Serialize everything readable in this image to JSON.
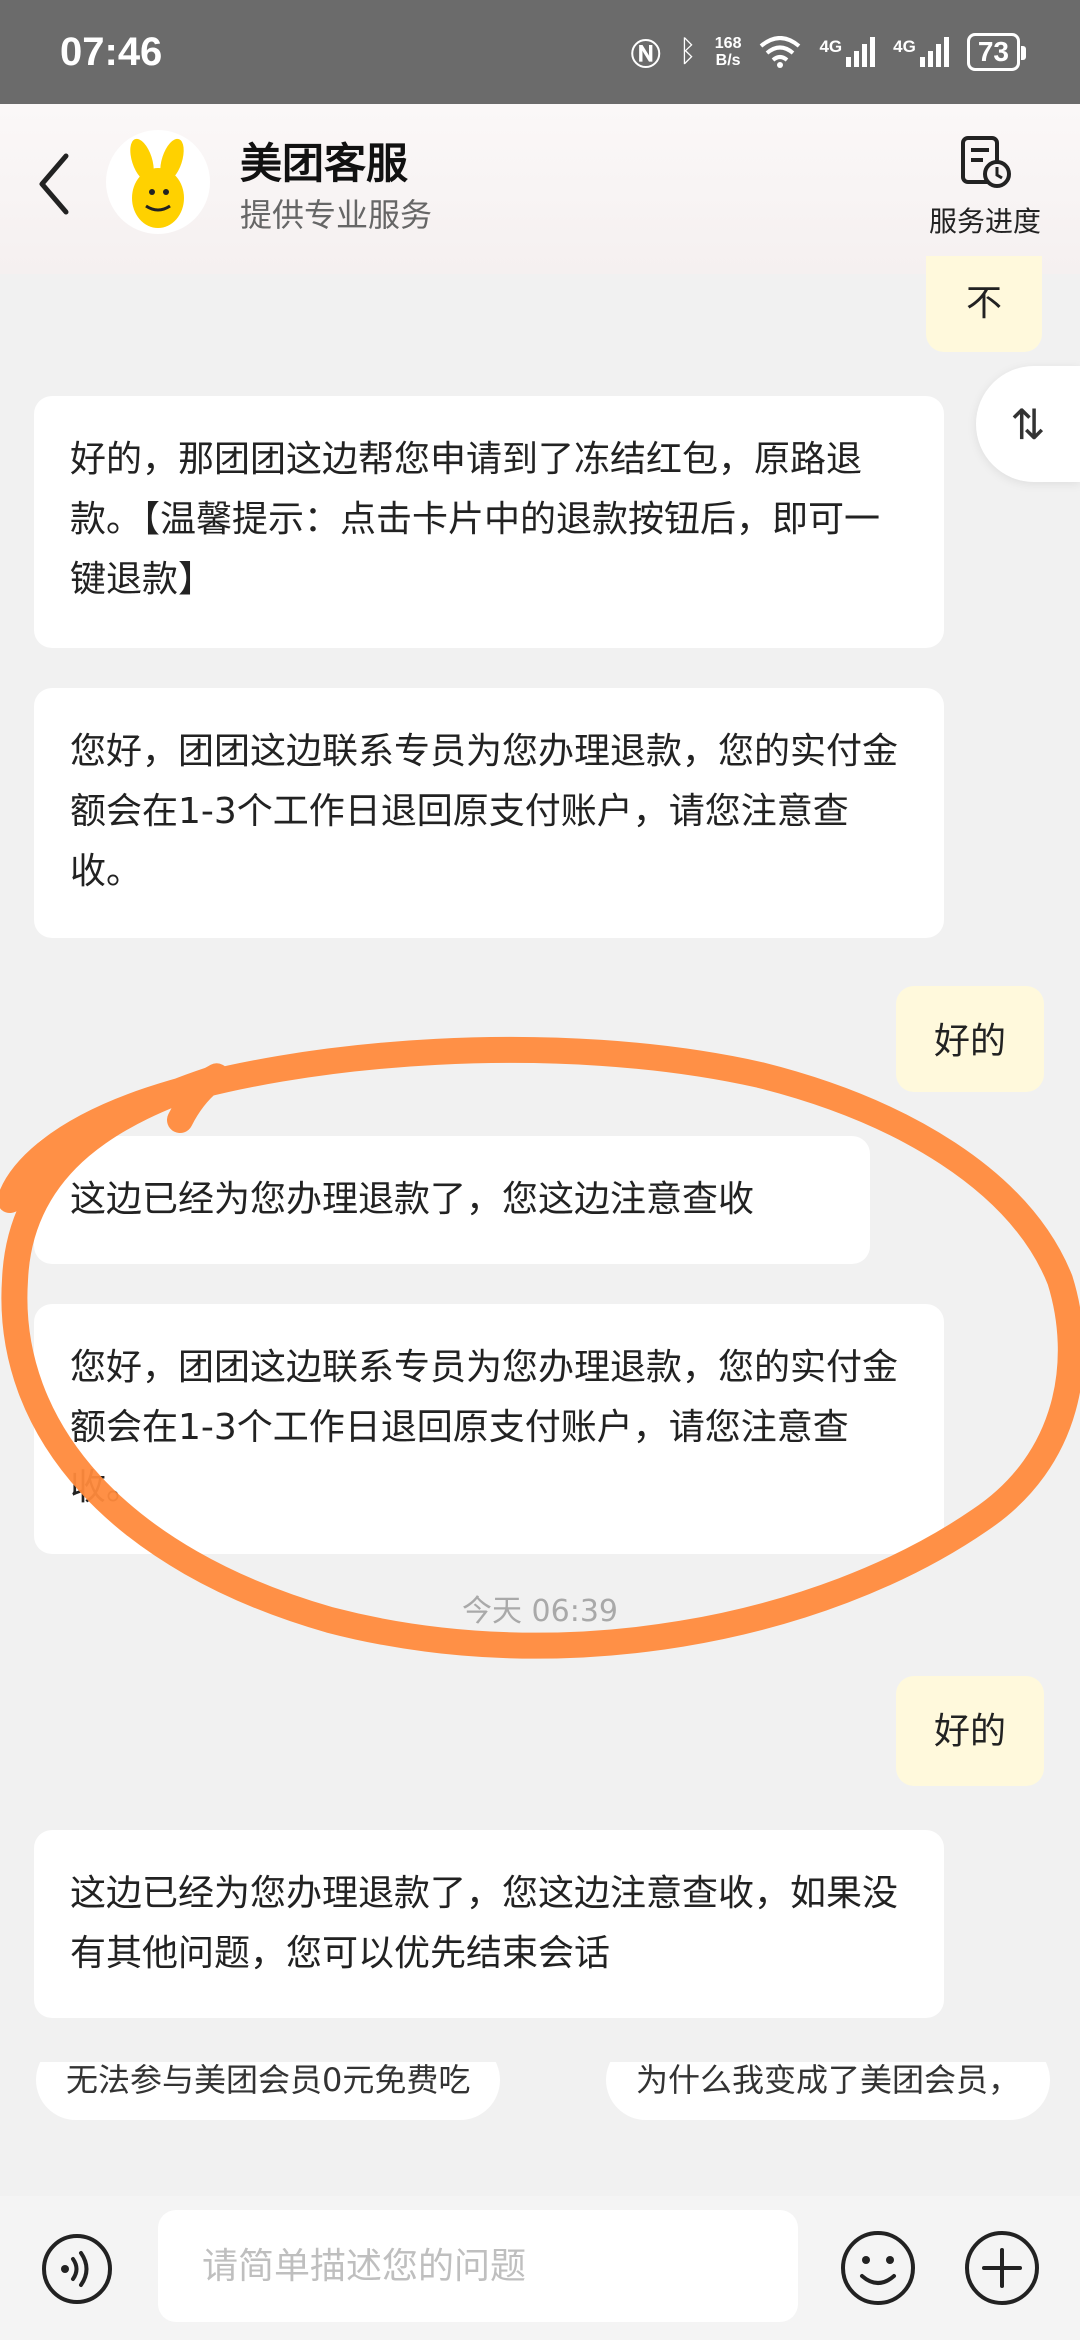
{
  "status": {
    "time": "07:46",
    "net_speed_top": "168",
    "net_speed_bottom": "B/s",
    "signal1": "4G",
    "signal2": "4G",
    "battery": "73"
  },
  "header": {
    "title": "美团客服",
    "subtitle": "提供专业服务",
    "progress_label": "服务进度"
  },
  "messages": [
    {
      "from": "user",
      "text": "不"
    },
    {
      "from": "agent",
      "text": "好的，那团团这边帮您申请到了冻结红包，原路退款。【温馨提示：点击卡片中的退款按钮后，即可一键退款】"
    },
    {
      "from": "agent",
      "text": "您好，团团这边联系专员为您办理退款，您的实付金额会在1-3个工作日退回原支付账户，请您注意查收。"
    },
    {
      "from": "user",
      "text": "好的"
    },
    {
      "from": "agent",
      "text": "这边已经为您办理退款了，您这边注意查收"
    },
    {
      "from": "agent",
      "text": "您好，团团这边联系专员为您办理退款，您的实付金额会在1-3个工作日退回原支付账户，请您注意查收。"
    },
    {
      "from": "user",
      "text": "好的"
    },
    {
      "from": "agent",
      "text": "这边已经为您办理退款了，您这边注意查收，如果没有其他问题，您可以优先结束会话"
    }
  ],
  "timestamp": "今天 06:39",
  "suggestions": [
    "无法参与美团会员0元免费吃",
    "为什么我变成了美团会员，"
  ],
  "input": {
    "placeholder": "请简单描述您的问题"
  },
  "colors": {
    "user_bubble": "#fff9dc",
    "agent_bubble": "#ffffff",
    "annotation_stroke": "#ff8a3c",
    "status_bar": "#6b6b6b"
  }
}
